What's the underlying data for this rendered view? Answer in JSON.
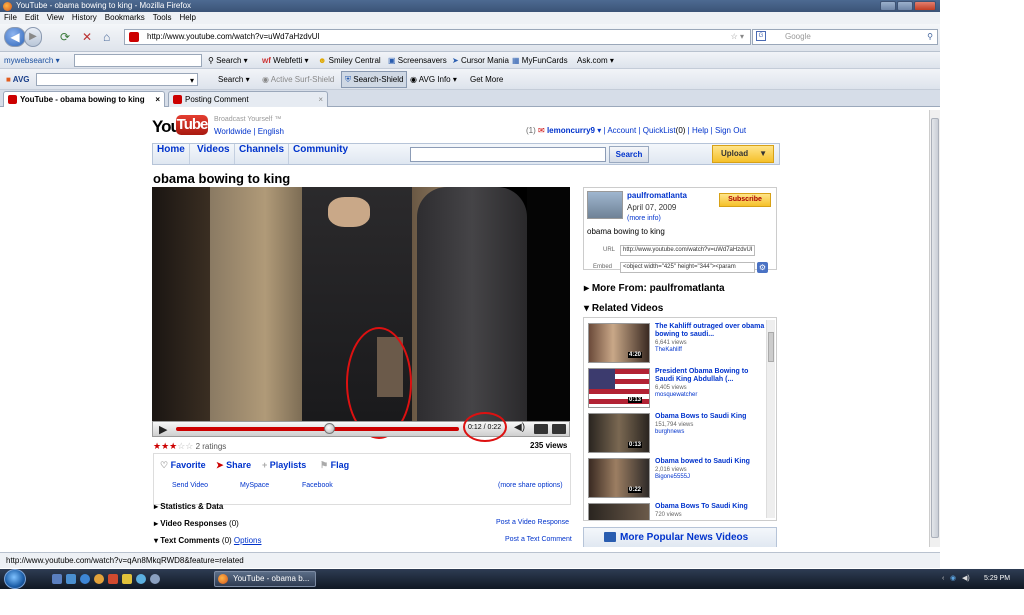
{
  "browser": {
    "title": "YouTube - obama bowing to king - Mozilla Firefox",
    "menu": [
      "File",
      "Edit",
      "View",
      "History",
      "Bookmarks",
      "Tools",
      "Help"
    ],
    "url": "http://www.youtube.com/watch?v=uWd7aHzdvUI",
    "search_placeholder": "Google",
    "toolbar1": {
      "mywebsearch": "mywebsearch",
      "search": "Search",
      "webfetti": "Webfetti",
      "smiley": "Smiley Central",
      "screensavers": "Screensavers",
      "cursormania": "Cursor Mania",
      "myfuncards": "MyFunCards",
      "ask": "Ask.com"
    },
    "toolbar2": {
      "avg": "AVG",
      "search": "Search",
      "active": "Active Surf-Shield",
      "shield": "Search-Shield",
      "info": "AVG Info",
      "more": "Get More"
    },
    "tabs": [
      "YouTube - obama bowing to king",
      "Posting Comment"
    ],
    "status": "http://www.youtube.com/watch?v=qAn8MkqRWD8&feature=related",
    "taskbar_item": "YouTube - obama b...",
    "clock": "5:29 PM"
  },
  "yt": {
    "logo_you": "You",
    "logo_tube": "Tube",
    "tagline": "Broadcast Yourself ™",
    "lang": "Worldwide | English",
    "user": "(1)",
    "username": "lemoncurry9",
    "account": "Account",
    "quicklist": "QuickList",
    "quicklist_count": "(0)",
    "help": "Help",
    "signout": "Sign Out",
    "nav": [
      "Home",
      "Videos",
      "Channels",
      "Community"
    ],
    "search_btn": "Search",
    "upload": "Upload",
    "video_title": "obama bowing to king",
    "time": "0:12 / 0:22",
    "ratings": "2 ratings",
    "views": "235 views",
    "actions": [
      "Favorite",
      "Share",
      "Playlists",
      "Flag"
    ],
    "share_links": [
      "Send Video",
      "MySpace",
      "Facebook"
    ],
    "more_share": "(more share options)",
    "stats": "Statistics & Data",
    "responses": "Video Responses",
    "responses_count": "(0)",
    "post_response": "Post a Video Response",
    "comments": "Text Comments",
    "comments_count": "(0)",
    "options": "Options",
    "post_comment": "Post a Text Comment",
    "uploader": "paulfromatlanta",
    "upload_date": "April 07, 2009",
    "more_info": "(more info)",
    "description": "obama bowing to king",
    "subscribe": "Subscribe",
    "url_label": "URL",
    "url_value": "http://www.youtube.com/watch?v=uWd7aHzdvUI",
    "embed_label": "Embed",
    "embed_value": "<object width=\"425\" height=\"344\"><param",
    "more_from": "More From: paulfromatlanta",
    "related_title": "Related Videos",
    "related": [
      {
        "title": "The Kahliff outraged over obama bowing to saudi...",
        "views": "6,641 views",
        "user": "TheKahliff",
        "dur": "4:20"
      },
      {
        "title": "President Obama Bowing to Saudi King Abdullah (...",
        "views": "6,405 views",
        "user": "mosquewatcher",
        "dur": "0:13"
      },
      {
        "title": "Obama Bows to Saudi King",
        "views": "151,794 views",
        "user": "burghnews",
        "dur": "0:13"
      },
      {
        "title": "Obama bowed to Saudi King",
        "views": "2,016 views",
        "user": "Bigone5555J",
        "dur": "0:22"
      },
      {
        "title": "Obama Bows To Saudi King",
        "views": "720 views",
        "user": "",
        "dur": ""
      }
    ],
    "more_popular": "More Popular News Videos"
  },
  "colors": {
    "accent": "#0033cc",
    "brand": "#cc0000",
    "annotation": "#dd1111"
  }
}
